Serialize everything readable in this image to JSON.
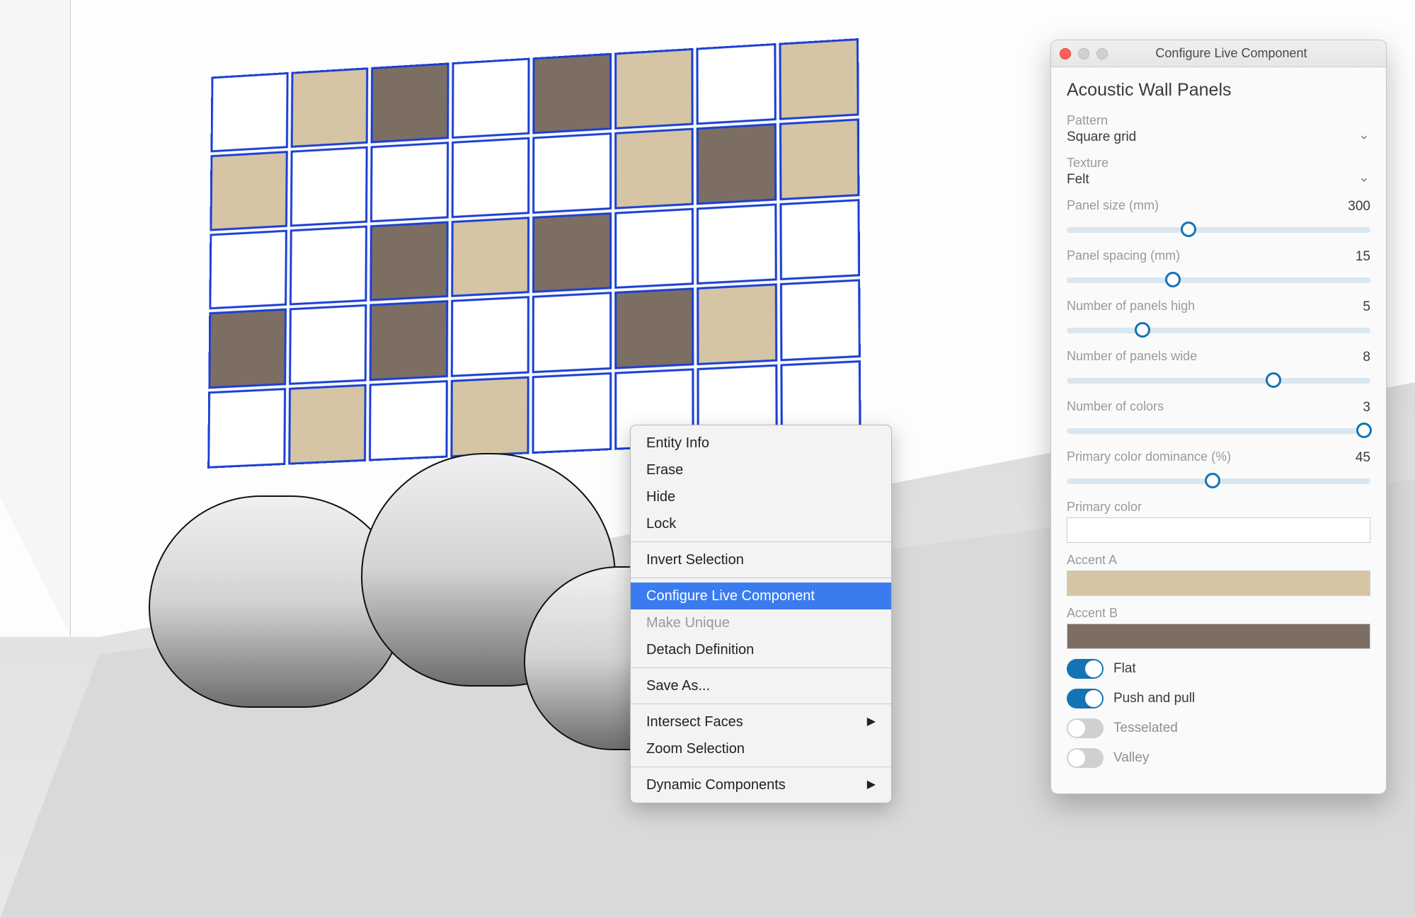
{
  "window": {
    "title": "Configure Live Component",
    "panel_title": "Acoustic Wall Panels"
  },
  "context_menu": {
    "items": [
      {
        "label": "Entity Info",
        "highlighted": false,
        "disabled": false,
        "submenu": false
      },
      {
        "label": "Erase",
        "highlighted": false,
        "disabled": false,
        "submenu": false
      },
      {
        "label": "Hide",
        "highlighted": false,
        "disabled": false,
        "submenu": false
      },
      {
        "label": "Lock",
        "highlighted": false,
        "disabled": false,
        "submenu": false
      },
      {
        "sep": true
      },
      {
        "label": "Invert Selection",
        "highlighted": false,
        "disabled": false,
        "submenu": false
      },
      {
        "sep": true
      },
      {
        "label": "Configure Live Component",
        "highlighted": true,
        "disabled": false,
        "submenu": false
      },
      {
        "label": "Make Unique",
        "highlighted": false,
        "disabled": true,
        "submenu": false
      },
      {
        "label": "Detach Definition",
        "highlighted": false,
        "disabled": false,
        "submenu": false
      },
      {
        "sep": true
      },
      {
        "label": "Save As...",
        "highlighted": false,
        "disabled": false,
        "submenu": false
      },
      {
        "sep": true
      },
      {
        "label": "Intersect Faces",
        "highlighted": false,
        "disabled": false,
        "submenu": true
      },
      {
        "label": "Zoom Selection",
        "highlighted": false,
        "disabled": false,
        "submenu": false
      },
      {
        "sep": true
      },
      {
        "label": "Dynamic Components",
        "highlighted": false,
        "disabled": false,
        "submenu": true
      }
    ]
  },
  "form": {
    "pattern": {
      "label": "Pattern",
      "value": "Square grid"
    },
    "texture": {
      "label": "Texture",
      "value": "Felt"
    },
    "panel_size": {
      "label": "Panel size (mm)",
      "value": "300",
      "pct": 40
    },
    "panel_spacing": {
      "label": "Panel spacing (mm)",
      "value": "15",
      "pct": 35
    },
    "panels_high": {
      "label": "Number of panels high",
      "value": "5",
      "pct": 25
    },
    "panels_wide": {
      "label": "Number of panels wide",
      "value": "8",
      "pct": 68
    },
    "num_colors": {
      "label": "Number of colors",
      "value": "3",
      "pct": 98
    },
    "dominance": {
      "label": "Primary color dominance (%)",
      "value": "45",
      "pct": 48
    },
    "primary_color": {
      "label": "Primary color",
      "value": "#ffffff"
    },
    "accent_a": {
      "label": "Accent A",
      "value": "#d6c5a4"
    },
    "accent_b": {
      "label": "Accent B",
      "value": "#7d6e63"
    },
    "toggles": [
      {
        "label": "Flat",
        "on": true
      },
      {
        "label": "Push and pull",
        "on": true
      },
      {
        "label": "Tesselated",
        "on": false
      },
      {
        "label": "Valley",
        "on": false
      }
    ]
  },
  "panels": {
    "rows": 5,
    "cols": 8,
    "colors": [
      [
        1,
        2,
        3,
        1,
        3,
        2,
        1,
        2
      ],
      [
        2,
        1,
        1,
        1,
        1,
        2,
        3,
        2
      ],
      [
        1,
        1,
        3,
        2,
        3,
        1,
        1,
        1
      ],
      [
        3,
        1,
        3,
        1,
        1,
        3,
        2,
        1
      ],
      [
        1,
        2,
        1,
        2,
        1,
        1,
        1,
        1
      ]
    ]
  }
}
